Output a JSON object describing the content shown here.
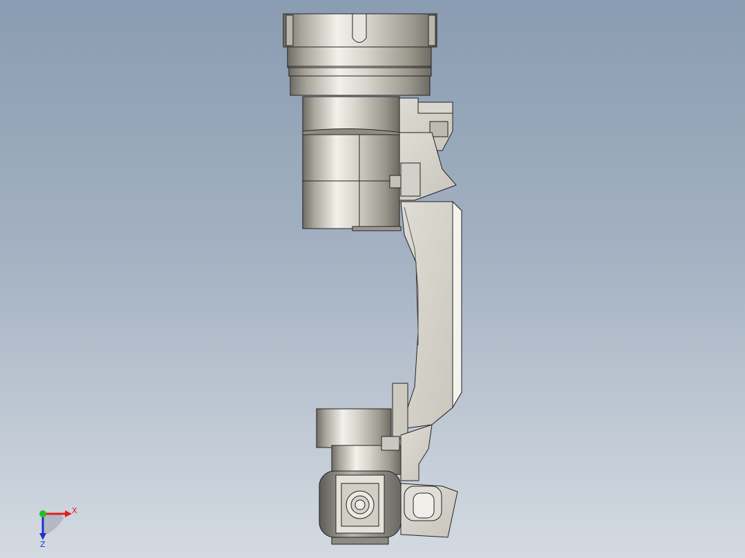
{
  "viewport": {
    "model": "robot-arm-side-view"
  },
  "triad": {
    "x_label": "X",
    "z_label": "Z",
    "x_color": "#e0201a",
    "y_color": "#22c020",
    "z_color": "#2030d0"
  }
}
